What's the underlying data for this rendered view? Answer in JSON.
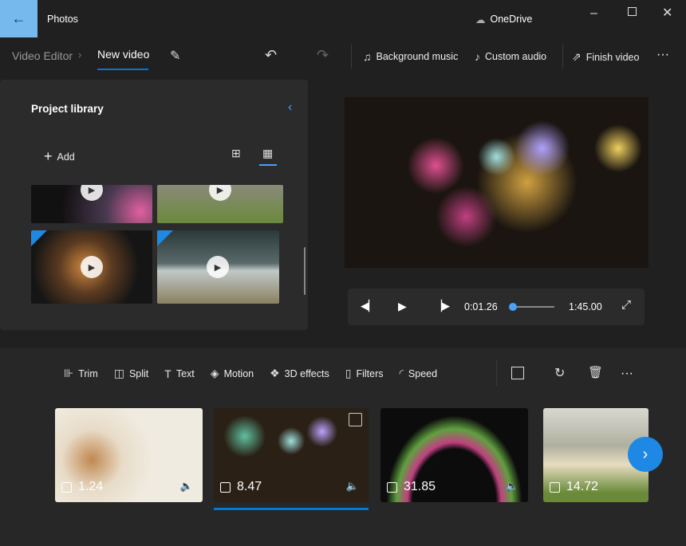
{
  "titlebar": {
    "app": "Photos",
    "onedrive": "OneDrive"
  },
  "toolbar": {
    "breadcrumb_root": "Video Editor",
    "current": "New video",
    "background_music": "Background music",
    "custom_audio": "Custom audio",
    "finish_video": "Finish video"
  },
  "library": {
    "title": "Project library",
    "add": "Add"
  },
  "player": {
    "current_time": "0:01.26",
    "total_time": "1:45.00",
    "progress": 0.012
  },
  "edit_tools": [
    "Trim",
    "Split",
    "Text",
    "Motion",
    "3D effects",
    "Filters",
    "Speed"
  ],
  "clips": [
    {
      "duration": "1.24"
    },
    {
      "duration": "8.47",
      "selected": true
    },
    {
      "duration": "31.85"
    },
    {
      "duration": "14.72"
    }
  ],
  "colors": {
    "accent": "#0078d4",
    "back_button": "#76b9ed"
  }
}
